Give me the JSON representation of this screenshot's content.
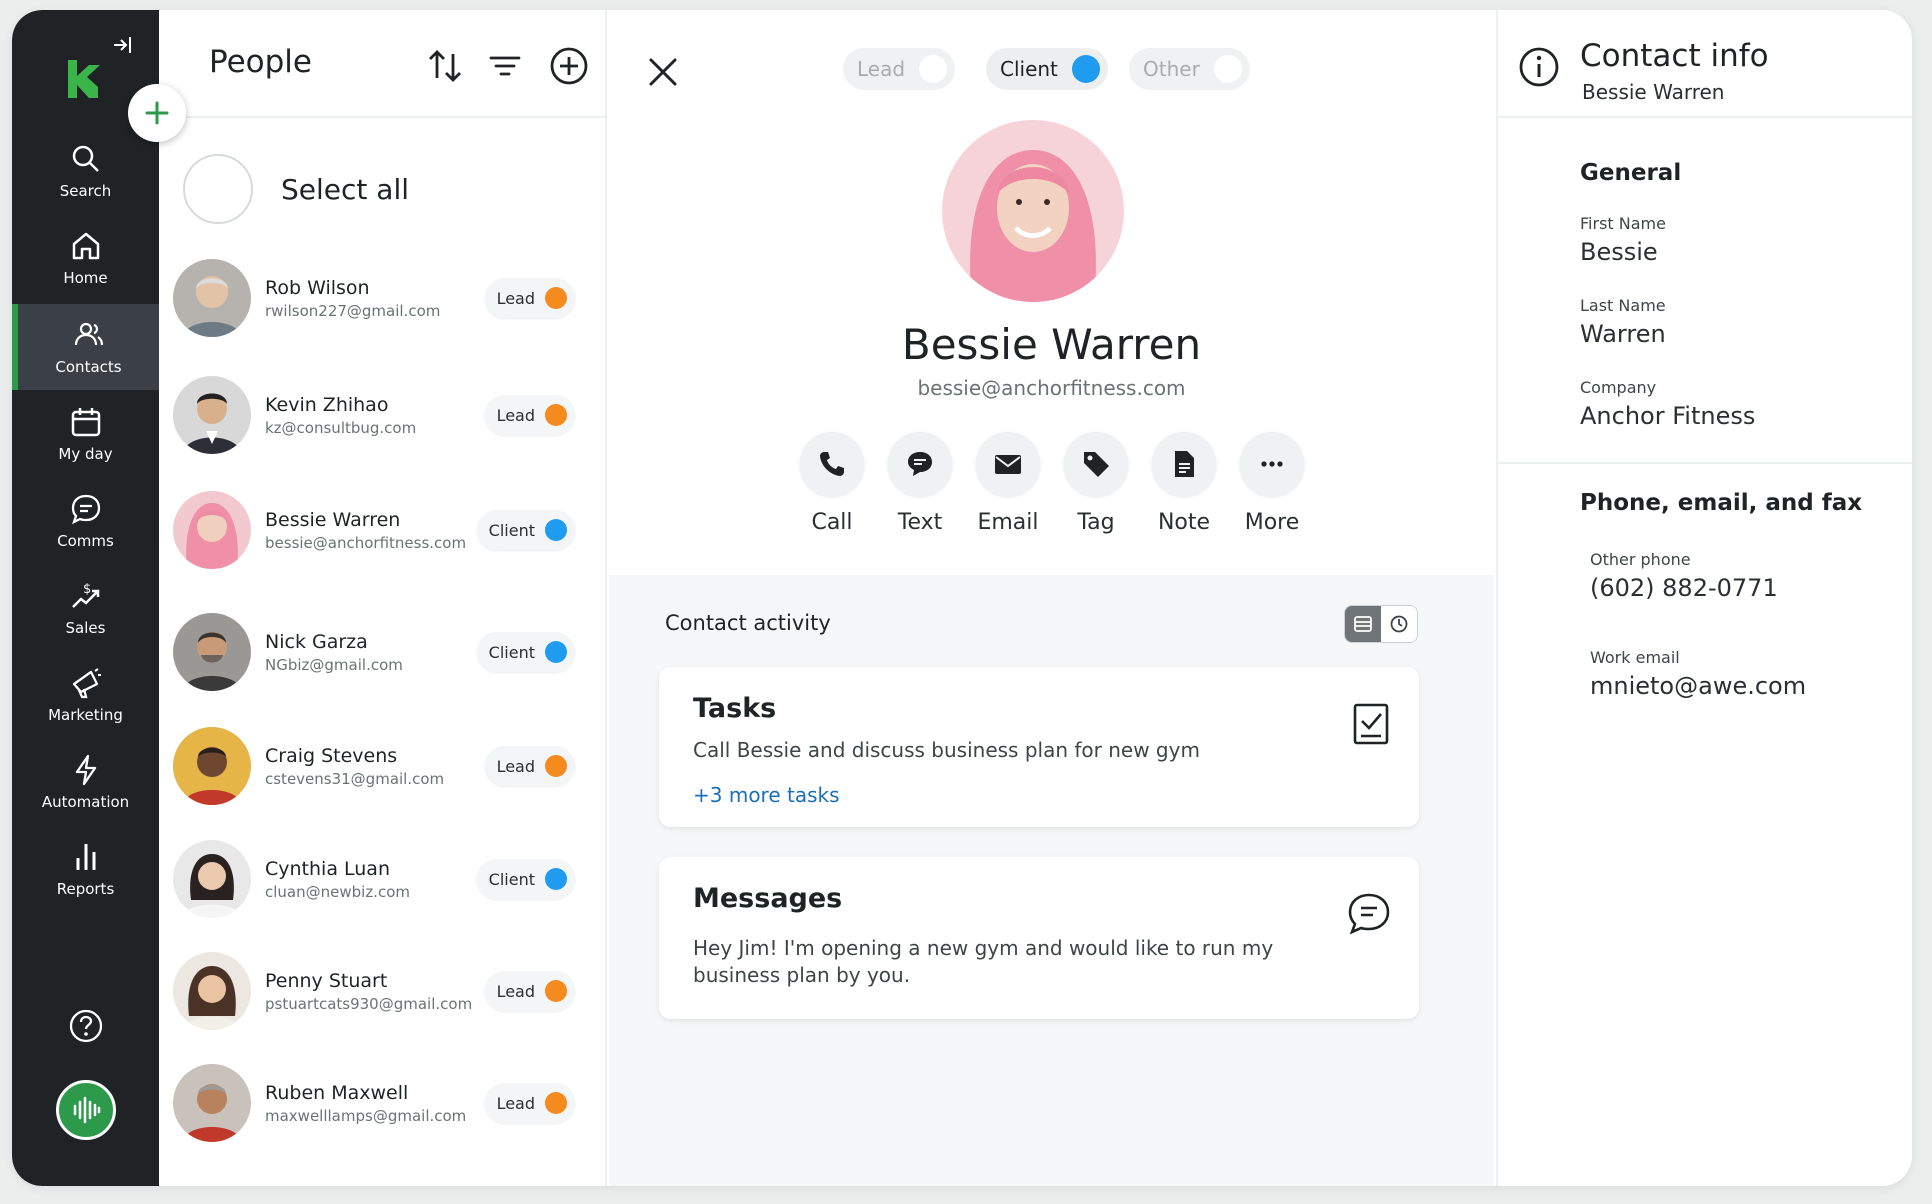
{
  "sidebar": {
    "items": [
      {
        "label": "Search",
        "icon": "search-icon"
      },
      {
        "label": "Home",
        "icon": "home-icon"
      },
      {
        "label": "Contacts",
        "icon": "contacts-icon",
        "active": true
      },
      {
        "label": "My day",
        "icon": "calendar-icon"
      },
      {
        "label": "Comms",
        "icon": "chat-icon"
      },
      {
        "label": "Sales",
        "icon": "sales-icon"
      },
      {
        "label": "Marketing",
        "icon": "megaphone-icon"
      },
      {
        "label": "Automation",
        "icon": "lightning-icon"
      },
      {
        "label": "Reports",
        "icon": "bar-chart-icon"
      }
    ]
  },
  "people": {
    "title": "People",
    "select_all": "Select all",
    "contacts": [
      {
        "name": "Rob Wilson",
        "email": "rwilson227@gmail.com",
        "status": "Lead"
      },
      {
        "name": "Kevin Zhihao",
        "email": "kz@consultbug.com",
        "status": "Lead"
      },
      {
        "name": "Bessie Warren",
        "email": "bessie@anchorfitness.com",
        "status": "Client"
      },
      {
        "name": "Nick Garza",
        "email": "NGbiz@gmail.com",
        "status": "Client"
      },
      {
        "name": "Craig Stevens",
        "email": "cstevens31@gmail.com",
        "status": "Lead"
      },
      {
        "name": "Cynthia Luan",
        "email": "cluan@newbiz.com",
        "status": "Client"
      },
      {
        "name": "Penny Stuart",
        "email": "pstuartcats930@gmail.com",
        "status": "Lead"
      },
      {
        "name": "Ruben Maxwell",
        "email": "maxwelllamps@gmail.com",
        "status": "Lead"
      }
    ]
  },
  "colors": {
    "lead": "#f58a1f",
    "client": "#1f9bf0",
    "brand": "#2c9a4a"
  },
  "detail": {
    "segments": {
      "lead": "Lead",
      "client": "Client",
      "other": "Other",
      "selected": "Client"
    },
    "name": "Bessie Warren",
    "email": "bessie@anchorfitness.com",
    "actions": [
      "Call",
      "Text",
      "Email",
      "Tag",
      "Note",
      "More"
    ],
    "activity_title": "Contact activity",
    "tasks": {
      "title": "Tasks",
      "body": "Call Bessie and discuss business plan for new gym",
      "more": "+3 more tasks"
    },
    "messages": {
      "title": "Messages",
      "line1": "Hey Jim! I'm opening a new gym and would like to run my",
      "line2": "business plan by you."
    }
  },
  "info": {
    "title": "Contact info",
    "subtitle": "Bessie Warren",
    "general_title": "General",
    "first_name_label": "First Name",
    "first_name": "Bessie",
    "last_name_label": "Last Name",
    "last_name": "Warren",
    "company_label": "Company",
    "company": "Anchor Fitness",
    "phone_section_title": "Phone, email, and fax",
    "other_phone_label": "Other phone",
    "other_phone": "(602) 882-0771",
    "work_email_label": "Work email",
    "work_email": "mnieto@awe.com"
  }
}
